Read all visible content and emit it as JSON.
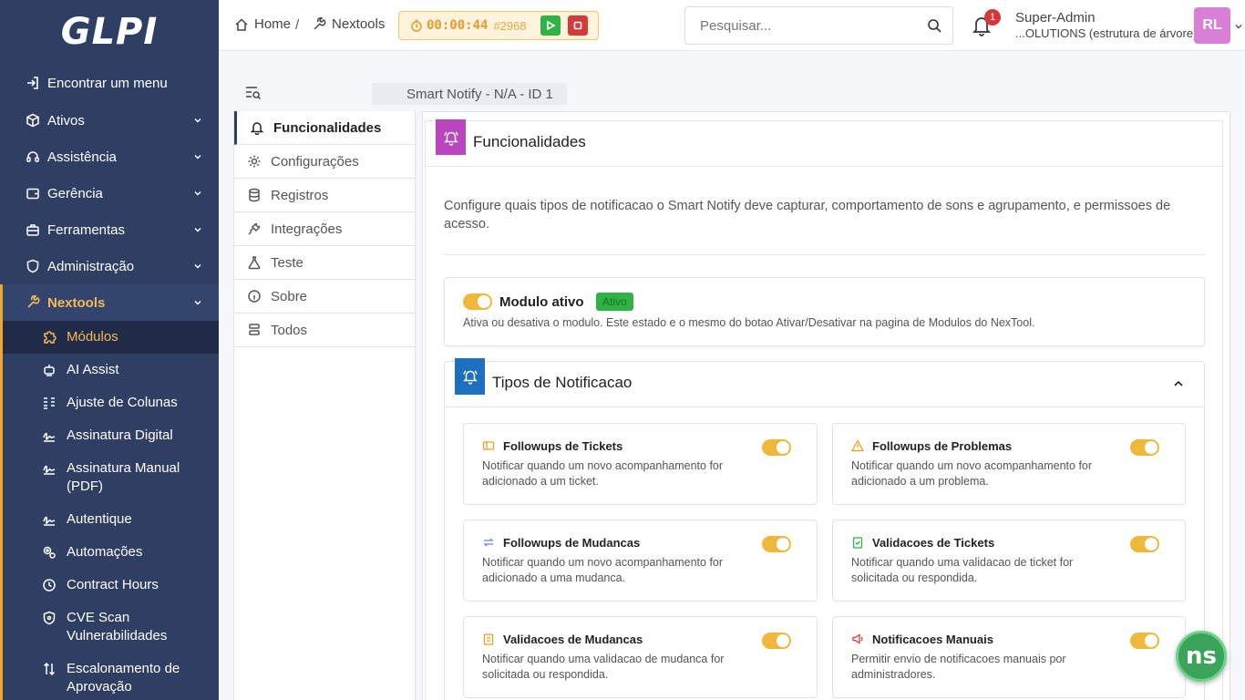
{
  "app": {
    "logo_text": "GLPI"
  },
  "sidebar": {
    "find_menu": "Encontrar um menu",
    "items": [
      {
        "label": "Ativos"
      },
      {
        "label": "Assistência"
      },
      {
        "label": "Gerência"
      },
      {
        "label": "Ferramentas"
      },
      {
        "label": "Administração"
      },
      {
        "label": "Nextools"
      }
    ],
    "submenu": [
      {
        "label": "Módulos"
      },
      {
        "label": "AI Assist"
      },
      {
        "label": "Ajuste de Colunas"
      },
      {
        "label": "Assinatura Digital"
      },
      {
        "label": "Assinatura Manual (PDF)"
      },
      {
        "label": "Autentique"
      },
      {
        "label": "Automações"
      },
      {
        "label": "Contract Hours"
      },
      {
        "label": "CVE Scan Vulnerabilidades"
      },
      {
        "label": "Escalonamento de Aprovação"
      }
    ]
  },
  "topbar": {
    "breadcrumb_home": "Home",
    "breadcrumb_sep": "/",
    "breadcrumb_nextools": "Nextools",
    "timer_time": "00:00:44",
    "timer_ticket": "#2968",
    "search_placeholder": "Pesquisar...",
    "notification_count": "1",
    "user_name": "Super-Admin",
    "user_entity": "...OLUTIONS (estrutura de árvore)",
    "avatar_initials": "RL"
  },
  "item": {
    "title": "Smart Notify -  N/A - ID 1"
  },
  "tabs": [
    {
      "label": "Funcionalidades"
    },
    {
      "label": "Configurações"
    },
    {
      "label": "Registros"
    },
    {
      "label": "Integrações"
    },
    {
      "label": "Teste"
    },
    {
      "label": "Sobre"
    },
    {
      "label": "Todos"
    }
  ],
  "panel": {
    "title": "Funcionalidades",
    "description": "Configure quais tipos de notificacao o Smart Notify deve capturar, comportamento de sons e agrupamento, e permissoes de acesso.",
    "module": {
      "title": "Modulo ativo",
      "status": "Ativo",
      "description": "Ativa ou desativa o modulo. Este estado e o mesmo do botao Ativar/Desativar na pagina de Modulos do NexTool.",
      "enabled": true
    },
    "types": {
      "title": "Tipos de Notificacao",
      "features": [
        {
          "title": "Followups de Tickets",
          "description": "Notificar quando um novo acompanhamento for adicionado a um ticket.",
          "enabled": true
        },
        {
          "title": "Followups de Problemas",
          "description": "Notificar quando um novo acompanhamento for adicionado a um problema.",
          "enabled": true
        },
        {
          "title": "Followups de Mudancas",
          "description": "Notificar quando um novo acompanhamento for adicionado a uma mudanca.",
          "enabled": true
        },
        {
          "title": "Validacoes de Tickets",
          "description": "Notificar quando uma validacao de ticket for solicitada ou respondida.",
          "enabled": true
        },
        {
          "title": "Validacoes de Mudancas",
          "description": "Notificar quando uma validacao de mudanca for solicitada ou respondida.",
          "enabled": true
        },
        {
          "title": "Notificacoes Manuais",
          "description": "Permitir envio de notificacoes manuais por administradores.",
          "enabled": true
        }
      ]
    }
  },
  "fab": {
    "label": "ns"
  },
  "colors": {
    "sidebar": "#2f3f64",
    "accent": "#f0a52c",
    "toggle": "#f0b83a",
    "success": "#2fb344",
    "panel_icon": "#b945bf",
    "types_icon": "#1d6fbf"
  }
}
